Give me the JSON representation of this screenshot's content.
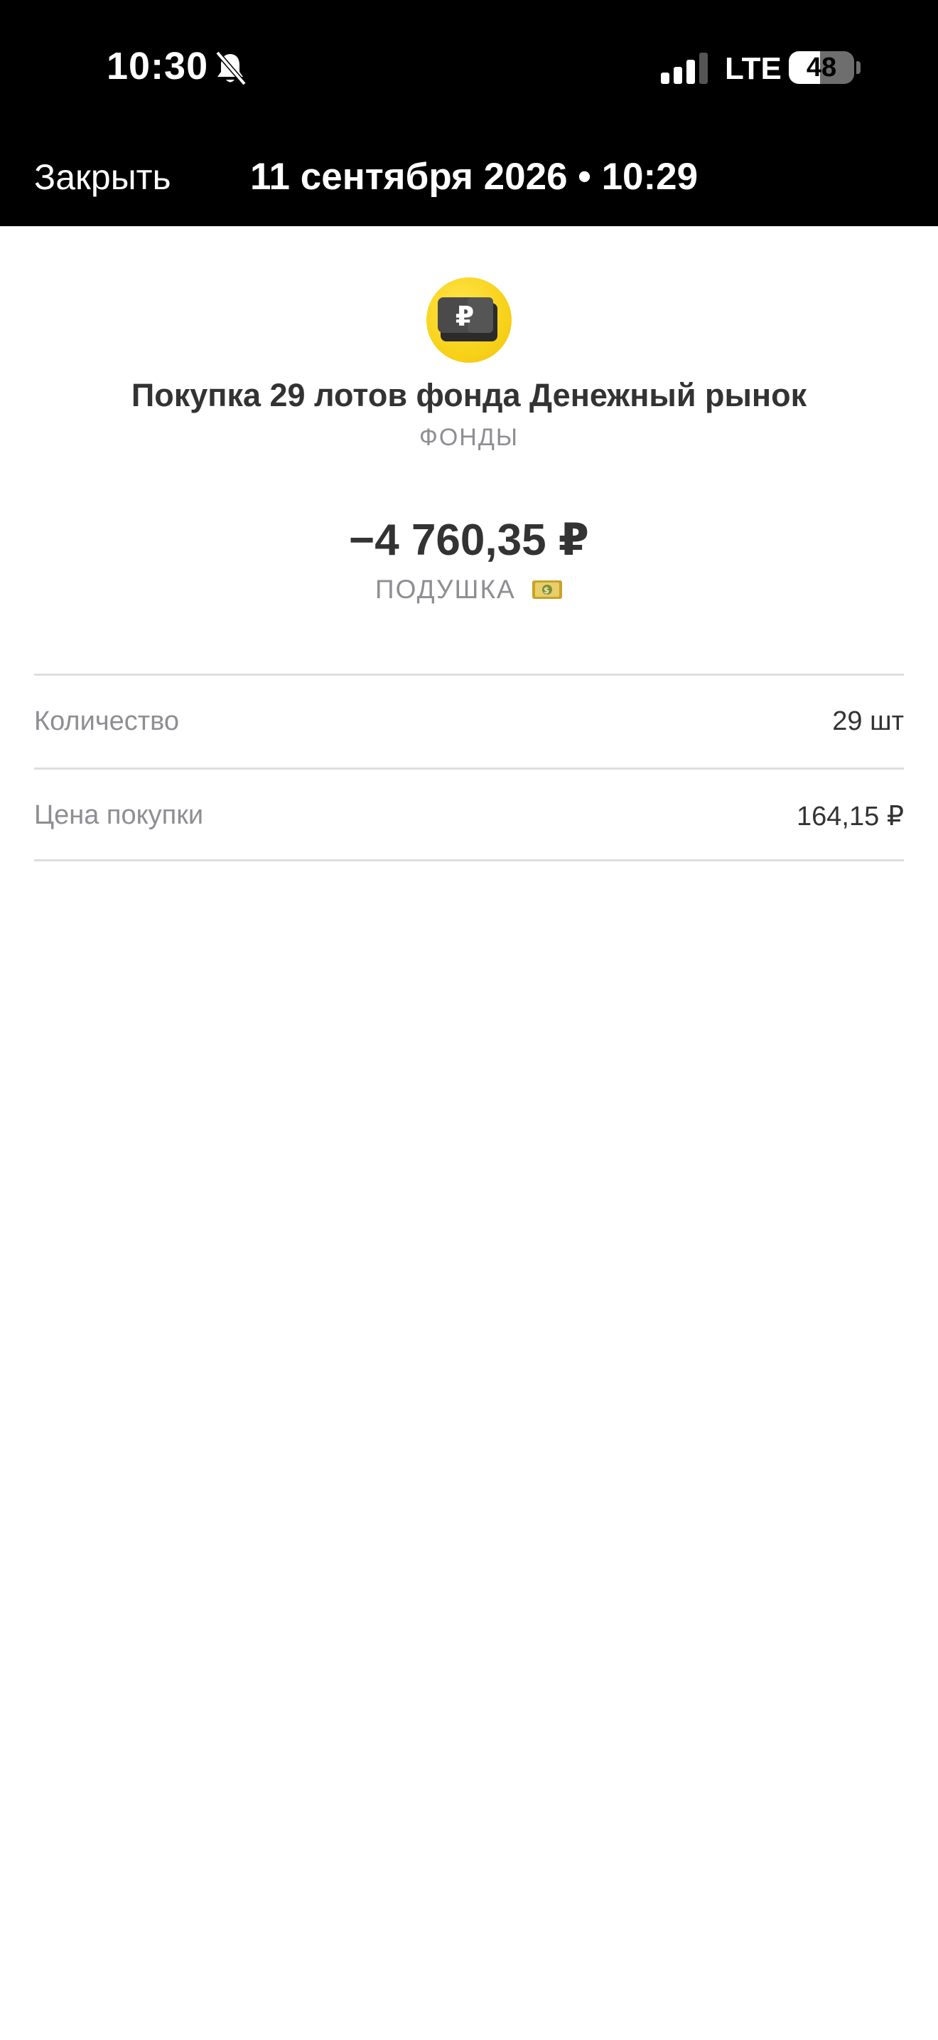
{
  "status_bar": {
    "time": "10:30",
    "network": "LTE",
    "battery_percent": "48",
    "battery_level": 0.48
  },
  "nav": {
    "close_label": "Закрыть",
    "title": "11 сентября 2026 • 10:29"
  },
  "operation": {
    "logo_icon": "ruble-wallet-icon",
    "title": "Покупка 29 лотов фонда Денежный рынок",
    "category": "ФОНДЫ",
    "amount": "−4 760,35 ₽",
    "account": "ПОДУШКА",
    "account_icon": "money-bill-icon"
  },
  "details": [
    {
      "label": "Количество",
      "value": "29 шт"
    },
    {
      "label": "Цена покупки",
      "value": "164,15 ₽"
    }
  ],
  "colors": {
    "header_bg": "#000000",
    "accent_yellow": "#f8d21a",
    "text_primary": "#333333",
    "text_secondary": "#8e8e93"
  }
}
